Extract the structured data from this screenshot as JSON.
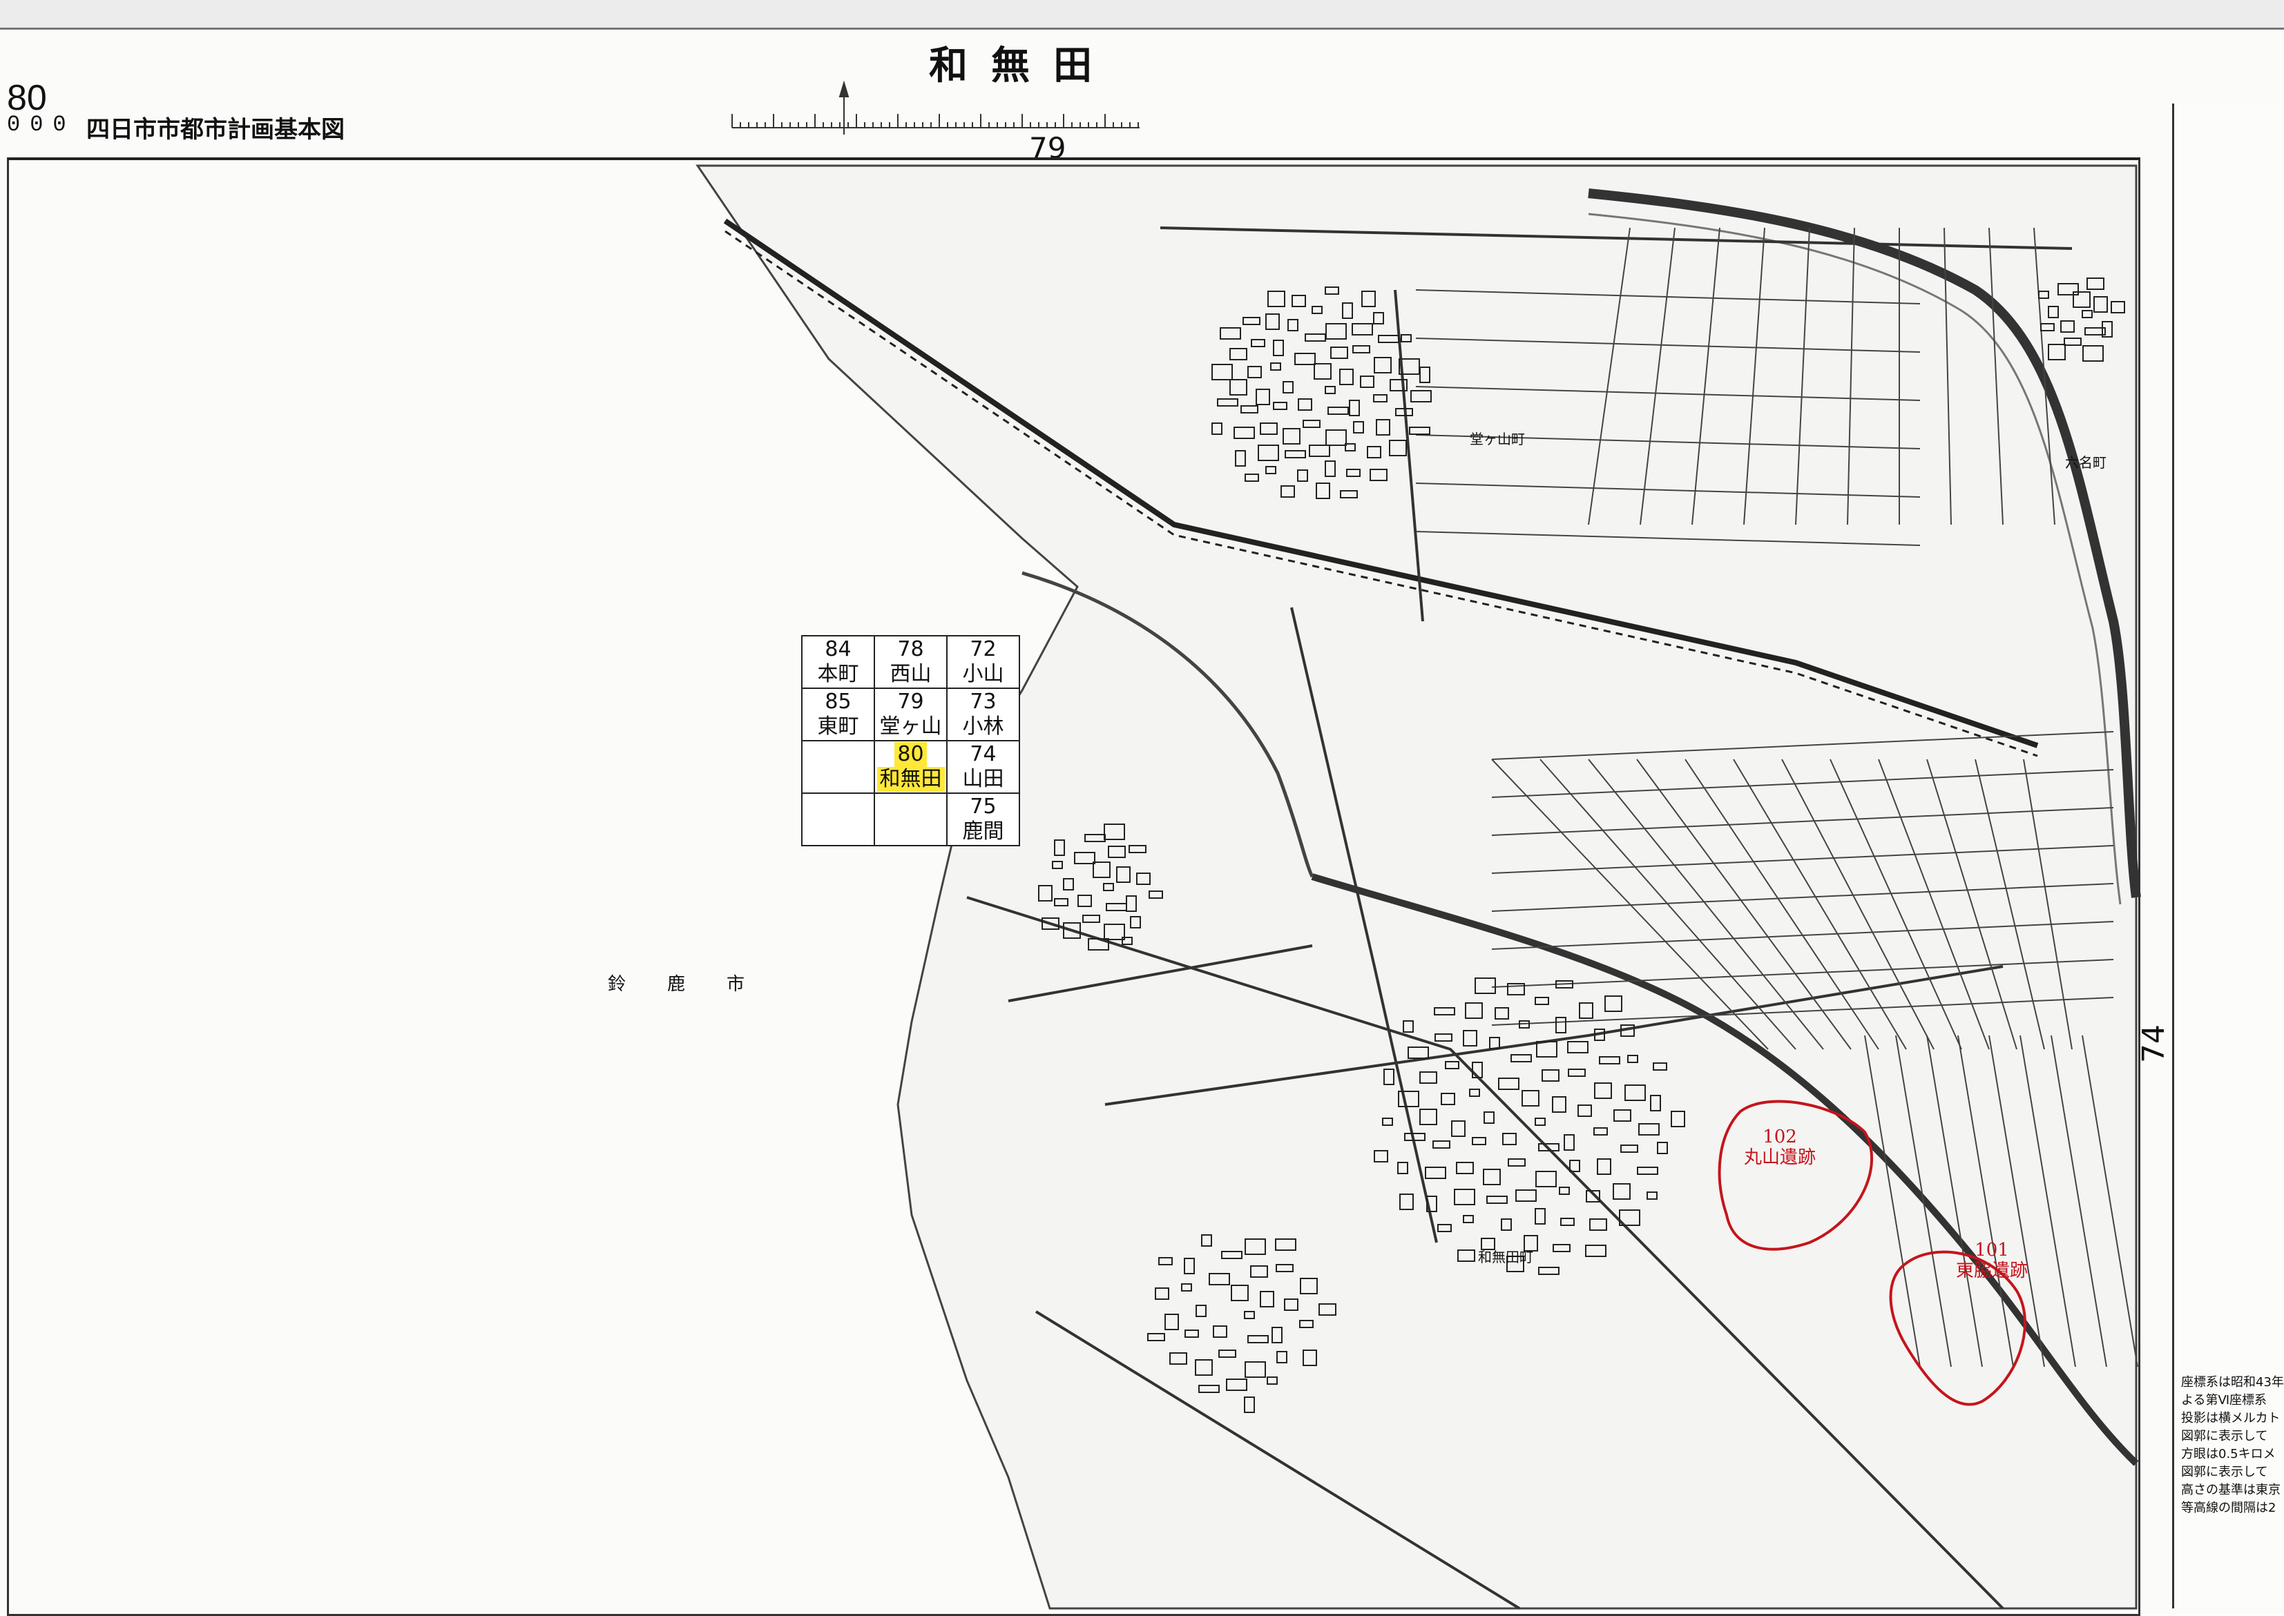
{
  "sheet": {
    "title": "和無田",
    "sheet_number": "80",
    "scale_text": "000",
    "series_title": "四日市市都市計画基本図",
    "grid_top": "79",
    "grid_right": "74"
  },
  "index_map": {
    "rows": [
      [
        {
          "num": "84",
          "name": "本町"
        },
        {
          "num": "78",
          "name": "西山"
        },
        {
          "num": "72",
          "name": "小山"
        }
      ],
      [
        {
          "num": "85",
          "name": "東町"
        },
        {
          "num": "79",
          "name": "堂ヶ山"
        },
        {
          "num": "73",
          "name": "小林"
        }
      ],
      [
        {
          "num": "",
          "name": ""
        },
        {
          "num": "80",
          "name": "和無田",
          "current": true
        },
        {
          "num": "74",
          "name": "山田"
        }
      ],
      [
        {
          "num": "",
          "name": ""
        },
        {
          "num": "",
          "name": ""
        },
        {
          "num": "75",
          "name": "鹿間"
        }
      ]
    ],
    "highlight_color": "#ffe838"
  },
  "map": {
    "city_label": "鈴鹿市",
    "town_labels": {
      "doga": "堂ヶ山町",
      "wamuta": "和無田町",
      "rokuna": "六名町"
    },
    "sites": [
      {
        "number": "102",
        "name": "丸山遺跡"
      },
      {
        "number": "101",
        "name": "東脇遺跡"
      }
    ],
    "site_color": "#c4151c"
  },
  "side_panel": {
    "note_lines": [
      "座標系は昭和43年",
      "よる第Ⅵ座標系",
      "投影は横メルカト",
      "図郭に表示して",
      "方眼は0.5キロメ",
      "図郭に表示して",
      "高さの基準は東京",
      "等高線の間隔は2"
    ]
  }
}
